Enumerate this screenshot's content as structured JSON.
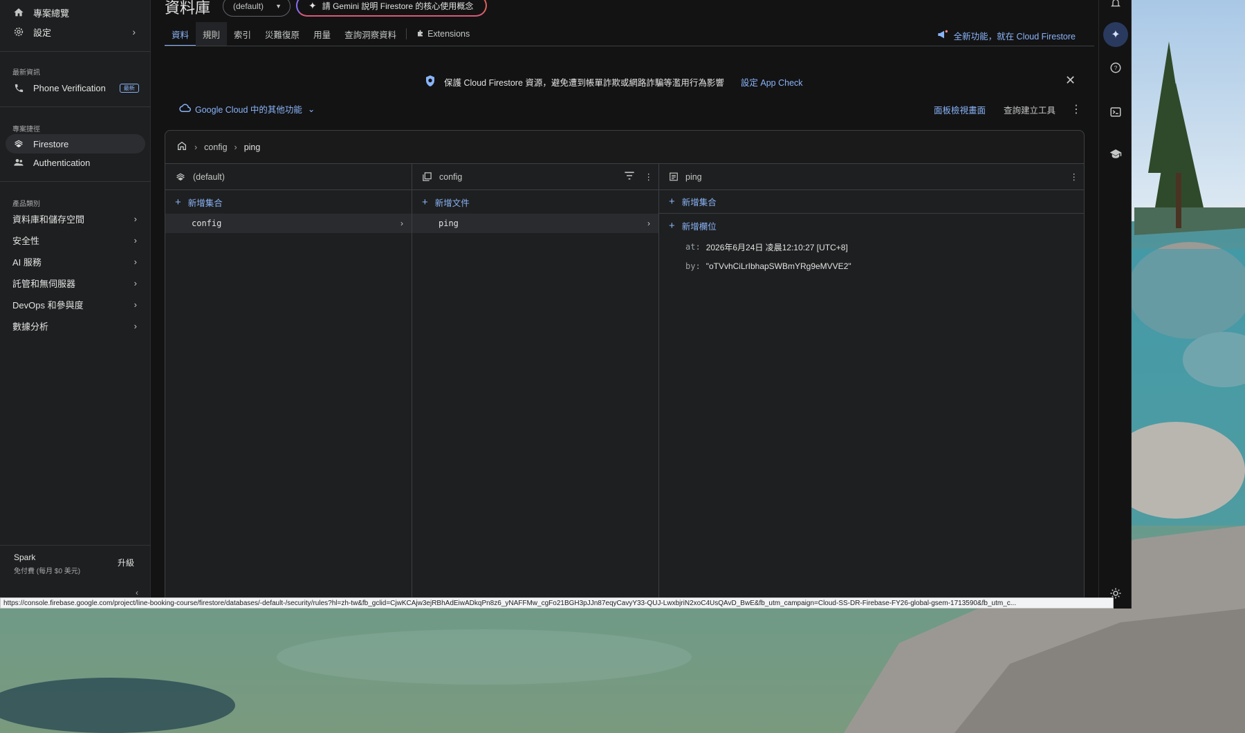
{
  "sidebar": {
    "top_items": [
      {
        "label": "專案總覽",
        "icon": "home-icon"
      },
      {
        "label": "設定",
        "icon": "gear-icon"
      }
    ],
    "latest_label": "最新資訊",
    "latest_item": {
      "label": "Phone Verification",
      "badge": "最新",
      "icon": "phone-icon"
    },
    "shortcuts_label": "專案捷徑",
    "shortcuts": [
      {
        "label": "Firestore",
        "icon": "firestore-icon",
        "active": true
      },
      {
        "label": "Authentication",
        "icon": "people-icon",
        "active": false
      }
    ],
    "categories_label": "產品類別",
    "categories": [
      {
        "label": "資料庫和儲存空間"
      },
      {
        "label": "安全性"
      },
      {
        "label": "AI 服務"
      },
      {
        "label": "託管和無伺服器"
      },
      {
        "label": "DevOps 和參與度"
      },
      {
        "label": "數據分析"
      }
    ],
    "plan": {
      "name": "Spark",
      "desc": "免付費 (每月 $0 美元)",
      "upgrade": "升級"
    }
  },
  "header": {
    "title": "資料庫",
    "db_select": "(default)",
    "gemini_prompt": "請 Gemini 說明 Firestore 的核心使用概念",
    "tabs": [
      {
        "label": "資料",
        "active": true
      },
      {
        "label": "規則",
        "active": false
      },
      {
        "label": "索引",
        "active": false
      },
      {
        "label": "災難復原",
        "active": false
      },
      {
        "label": "用量",
        "active": false
      },
      {
        "label": "查詢洞察資料",
        "active": false
      },
      {
        "label": "Extensions",
        "active": false
      }
    ],
    "whats_new": "全新功能，就在 Cloud Firestore"
  },
  "banner": {
    "text": "保護 Cloud Firestore 資源，避免遭到帳單詐欺或網路詐騙等濫用行為影響",
    "link": "設定 App Check"
  },
  "toolbar": {
    "gcloud": "Google Cloud 中的其他功能",
    "panel_view": "面板檢視畫面",
    "query_builder": "查詢建立工具"
  },
  "breadcrumb": [
    "config",
    "ping"
  ],
  "columns": {
    "root": {
      "title": "(default)",
      "add_label": "新增集合",
      "items": [
        "config"
      ]
    },
    "collection": {
      "title": "config",
      "add_label": "新增文件",
      "items": [
        "ping"
      ]
    },
    "document": {
      "title": "ping",
      "add_collection": "新增集合",
      "add_field": "新增欄位",
      "fields": [
        {
          "key": "at:",
          "value": "2026年6月24日 凌晨12:10:27 [UTC+8]"
        },
        {
          "key": "by:",
          "value": "\"oTVvhCiLrIbhapSWBmYRg9eMVVE2\""
        }
      ]
    }
  },
  "status_url": "https://console.firebase.google.com/project/line-booking-course/firestore/databases/-default-/security/rules?hl=zh-tw&fb_gclid=CjwKCAjw3ejRBhAdEiwADkqPn8z6_yNAFFMw_cgFo21BGH3pJJn87eqyCavyY33-QUJ-LwxbjriN2xoC4UsQAvD_BwE&fb_utm_campaign=Cloud-SS-DR-Firebase-FY26-global-gsem-1713590&fb_utm_c..."
}
